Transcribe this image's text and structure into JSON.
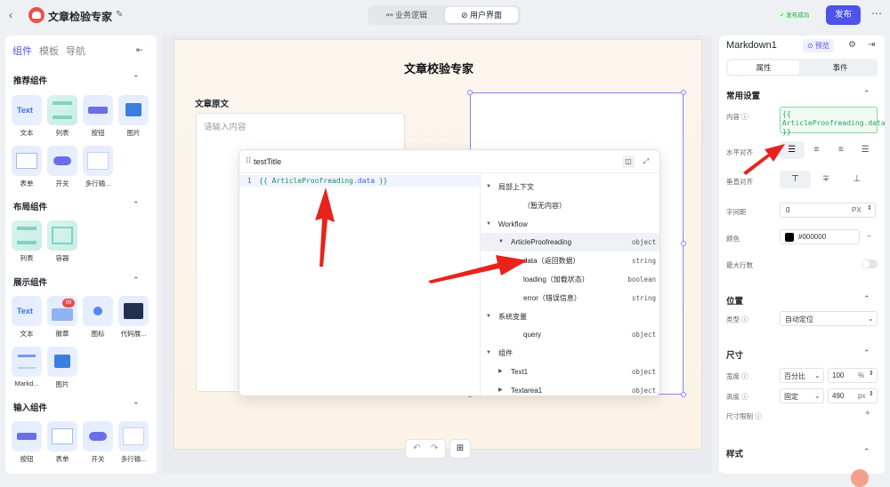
{
  "app": {
    "title": "文章检验专家",
    "back": "‹",
    "edit": "✎"
  },
  "top_tabs": [
    {
      "label": "业务逻辑",
      "icon": "⚯"
    },
    {
      "label": "用户界面",
      "icon": "⊘"
    }
  ],
  "status": "✓ 发布成功",
  "publish_label": "发布",
  "more": "⋯",
  "left_panel": {
    "tabs": [
      "组件",
      "模板",
      "导航"
    ],
    "sections": [
      {
        "title": "推荐组件",
        "items": [
          "文本",
          "列表",
          "按钮",
          "图片",
          "表单",
          "开关",
          "多行输..."
        ]
      },
      {
        "title": "布局组件",
        "items": [
          "列表",
          "容器"
        ]
      },
      {
        "title": "展示组件",
        "items": [
          "文本",
          "徽章",
          "图标",
          "代码展...",
          "Markd...",
          "图片"
        ]
      },
      {
        "title": "输入组件",
        "items": [
          "按钮",
          "表单",
          "开关",
          "多行输..."
        ]
      }
    ],
    "badge_count": "99",
    "text_glyph": "Text"
  },
  "canvas": {
    "page_title": "文章校验专家",
    "source_label": "文章原文",
    "source_placeholder": "请输入内容"
  },
  "popup": {
    "title": "testTitle",
    "line_number": "1",
    "code_prefix": "{{ ArticleProofreading.",
    "code_key": "data",
    "code_suffix": " }}",
    "tree": [
      {
        "name": "局部上下文",
        "type": "",
        "indent": 0,
        "tri": "▼"
      },
      {
        "name": "（暂无内容）",
        "type": "",
        "indent": 2,
        "tri": ""
      },
      {
        "name": "Workflow",
        "type": "",
        "indent": 0,
        "tri": "▼"
      },
      {
        "name": "ArticleProofreading",
        "type": "object",
        "indent": 1,
        "tri": "▼"
      },
      {
        "name": "data（返回数据）",
        "type": "string",
        "indent": 2,
        "tri": ""
      },
      {
        "name": "loading（加载状态）",
        "type": "boolean",
        "indent": 2,
        "tri": ""
      },
      {
        "name": "error（错误信息）",
        "type": "string",
        "indent": 2,
        "tri": ""
      },
      {
        "name": "系统变量",
        "type": "",
        "indent": 0,
        "tri": "▼"
      },
      {
        "name": "query",
        "type": "object",
        "indent": 2,
        "tri": ""
      },
      {
        "name": "组件",
        "type": "",
        "indent": 0,
        "tri": "▼"
      },
      {
        "name": "Text1",
        "type": "object",
        "indent": 1,
        "tri": "▶"
      },
      {
        "name": "Textarea1",
        "type": "object",
        "indent": 1,
        "tri": "▶"
      }
    ]
  },
  "right_panel": {
    "title": "Markdown1",
    "preview_label": "⊙ 预览",
    "tabs": [
      "属性",
      "事件"
    ],
    "common_title": "常用设置",
    "content_label": "内容",
    "content_value": "{{ ArticleProofreading.data }}",
    "h_align_label": "水平对齐",
    "v_align_label": "垂直对齐",
    "letter_spacing_label": "字间距",
    "letter_spacing_value": "0",
    "letter_spacing_unit": "PX",
    "color_label": "颜色",
    "color_value": "#000000",
    "max_lines_label": "最大行数",
    "position_title": "位置",
    "type_label": "类型",
    "type_value": "自动定位",
    "size_title": "尺寸",
    "width_label": "宽度",
    "width_mode": "百分比",
    "width_value": "100",
    "width_unit": "%",
    "height_label": "高度",
    "height_mode": "固定",
    "height_value": "490",
    "height_unit": "px",
    "size_limit_label": "尺寸限制",
    "style_title": "样式"
  },
  "colors": {
    "accent": "#4d53e8",
    "arrow": "#e8231c",
    "success": "#1fa14a"
  }
}
